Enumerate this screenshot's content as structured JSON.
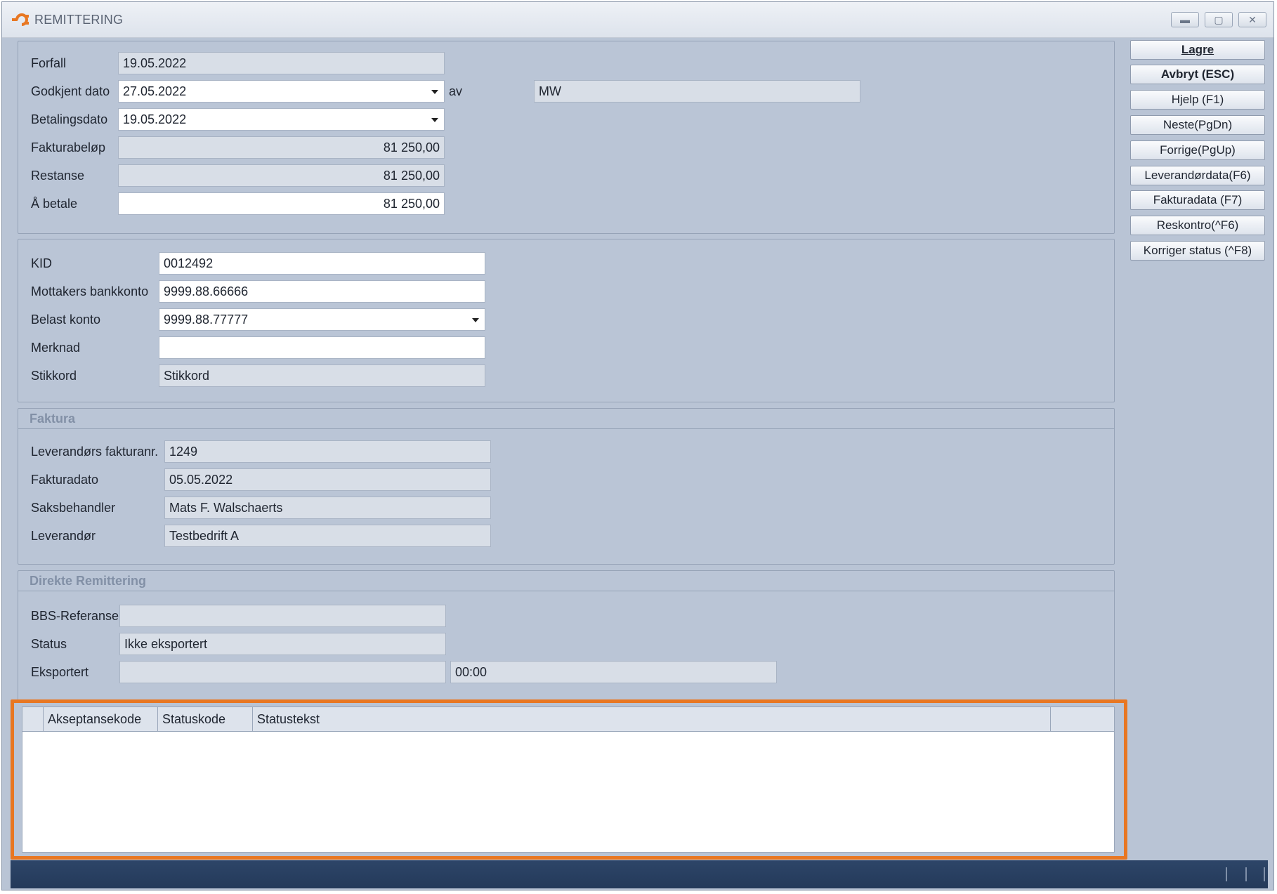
{
  "window": {
    "title": "REMITTERING"
  },
  "payment": {
    "forfall": {
      "label": "Forfall",
      "value": "19.05.2022"
    },
    "godkjent_dato": {
      "label": "Godkjent dato",
      "value": "27.05.2022",
      "av_label": "av",
      "av_value": "MW"
    },
    "betalingsdato": {
      "label": "Betalingsdato",
      "value": "19.05.2022"
    },
    "fakturabelop": {
      "label": "Fakturabeløp",
      "value": "81 250,00"
    },
    "restanse": {
      "label": "Restanse",
      "value": "81 250,00"
    },
    "a_betale": {
      "label": "Å betale",
      "value": "81 250,00"
    }
  },
  "account": {
    "kid": {
      "label": "KID",
      "value": "0012492"
    },
    "mottakers_bankkonto": {
      "label": "Mottakers bankkonto",
      "value": "9999.88.66666"
    },
    "belast_konto": {
      "label": "Belast konto",
      "value": "9999.88.77777"
    },
    "merknad": {
      "label": "Merknad",
      "value": ""
    },
    "stikkord": {
      "label": "Stikkord",
      "value": "Stikkord"
    }
  },
  "faktura": {
    "title": "Faktura",
    "leverandors_fakturanr": {
      "label": "Leverandørs fakturanr.",
      "value": "1249"
    },
    "fakturadato": {
      "label": "Fakturadato",
      "value": "05.05.2022"
    },
    "saksbehandler": {
      "label": "Saksbehandler",
      "value": "Mats F. Walschaerts"
    },
    "leverandor": {
      "label": "Leverandør",
      "value": "Testbedrift A"
    }
  },
  "direkte": {
    "title": "Direkte Remittering",
    "bbs_referanse": {
      "label": "BBS-Referanse",
      "value": ""
    },
    "status": {
      "label": "Status",
      "value": "Ikke eksportert"
    },
    "eksportert": {
      "label": "Eksportert",
      "date": "",
      "time": "00:00"
    }
  },
  "grid": {
    "columns": [
      "Akseptansekode",
      "Statuskode",
      "Statustekst"
    ],
    "highlight_color": "#e87722"
  },
  "buttons": {
    "lagre": "Lagre",
    "avbryt": "Avbryt (ESC)",
    "hjelp": "Hjelp (F1)",
    "neste": "Neste(PgDn)",
    "forrige": "Forrige(PgUp)",
    "leverandordata": "Leverandørdata(F6)",
    "fakturadata": "Fakturadata (F7)",
    "reskontro": "Reskontro(^F6)",
    "korriger_status": "Korriger status (^F8)"
  }
}
